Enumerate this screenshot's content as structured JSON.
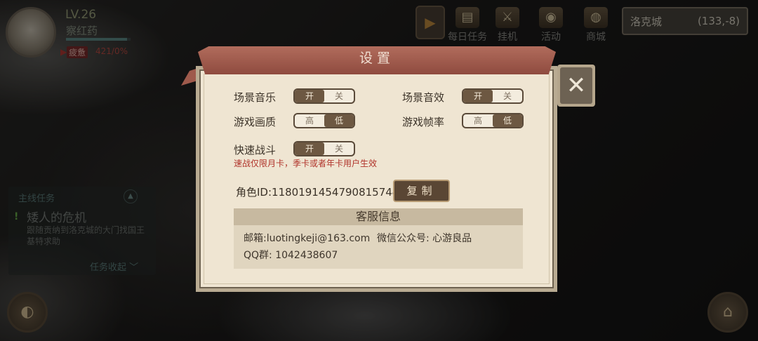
{
  "player": {
    "level": "LV.26",
    "name": "察红药",
    "status_badge": "疲惫",
    "status_value": "421/0%",
    "hp_fraction": 0.95
  },
  "nav": {
    "daily_tasks": "每日任务",
    "idle": "挂机",
    "events": "活动",
    "shop": "商城"
  },
  "location": {
    "name": "洛克城",
    "coords": "(133,-8)"
  },
  "quest": {
    "header": "主线任务",
    "title": "矮人的危机",
    "description": "跟随贡纳到洛克城的大门找国王基特求助",
    "collapse": "任务收起"
  },
  "settings": {
    "title": "设置",
    "scene_music": {
      "label": "场景音乐",
      "on": "开",
      "off": "关",
      "selected": "on"
    },
    "scene_sfx": {
      "label": "场景音效",
      "on": "开",
      "off": "关",
      "selected": "on"
    },
    "quality": {
      "label": "游戏画质",
      "high": "高",
      "low": "低",
      "selected": "low"
    },
    "framerate": {
      "label": "游戏帧率",
      "high": "高",
      "low": "低",
      "selected": "low"
    },
    "quick_battle": {
      "label": "快速战斗",
      "on": "开",
      "off": "关",
      "selected": "on"
    },
    "quick_battle_note": "速战仅限月卡，季卡或者年卡用户生效",
    "role_id": "角色ID:1180191454790815744",
    "copy": "复制",
    "service": {
      "title": "客服信息",
      "email": "邮箱:luotingkeji@163.com",
      "wechat": "微信公众号: 心游良品",
      "qq": "QQ群: 1042438607"
    }
  },
  "colors": {
    "ribbon": "#a35e50",
    "panel": "#efe5d2",
    "toggle_on": "#6d5842",
    "note_red": "#b0332a"
  },
  "icons": [
    "close-icon",
    "play-icon",
    "scroll-icon",
    "swords-icon",
    "drum-icon",
    "basket-icon",
    "navigation-icon",
    "house-icon",
    "map-icon"
  ]
}
